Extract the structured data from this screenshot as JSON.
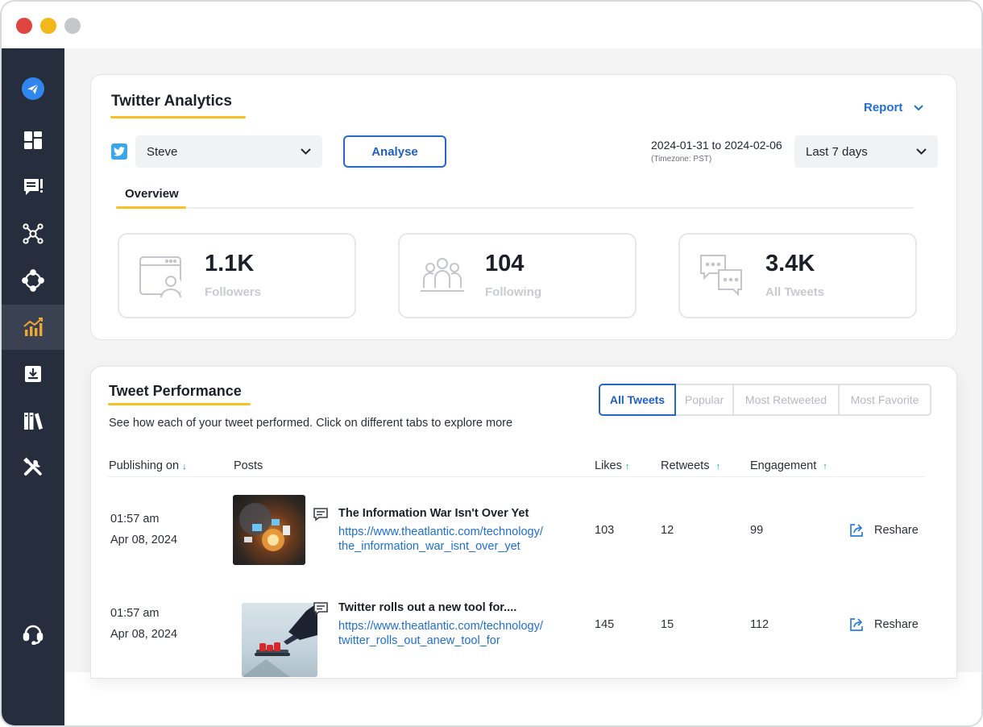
{
  "window": {
    "controls": [
      "close",
      "minimize",
      "maximize"
    ]
  },
  "sidebar": {
    "items": [
      {
        "icon": "send-icon",
        "active": false
      },
      {
        "icon": "dashboard-icon",
        "active": false
      },
      {
        "icon": "message-alert-icon",
        "active": false
      },
      {
        "icon": "network-icon",
        "active": false
      },
      {
        "icon": "hub-icon",
        "active": false
      },
      {
        "icon": "analytics-chart-icon",
        "active": true
      },
      {
        "icon": "download-tray-icon",
        "active": false
      },
      {
        "icon": "library-icon",
        "active": false
      },
      {
        "icon": "tools-icon",
        "active": false
      },
      {
        "icon": "headset-icon",
        "active": false
      }
    ]
  },
  "analytics": {
    "title": "Twitter Analytics",
    "report_label": "Report",
    "account": {
      "selected": "Steve"
    },
    "analyse_label": "Analyse",
    "date_range": "2024-01-31 to 2024-02-06",
    "timezone": "(Timezone: PST)",
    "range_selected": "Last 7 days",
    "tab": "Overview",
    "stats": [
      {
        "value": "1.1K",
        "label": "Followers",
        "icon": "followers-icon"
      },
      {
        "value": "104",
        "label": "Following",
        "icon": "following-group-icon"
      },
      {
        "value": "3.4K",
        "label": "All Tweets",
        "icon": "tweets-chat-icon"
      }
    ]
  },
  "performance": {
    "title": "Tweet Performance",
    "subtitle": "See how each of your tweet performed. Click on different tabs to explore more",
    "tabs": [
      "All Tweets",
      "Popular",
      "Most Retweeted",
      "Most Favorite"
    ],
    "active_tab": "All Tweets",
    "columns": {
      "publishing": "Publishing on",
      "posts": "Posts",
      "likes": "Likes",
      "retweets": "Retweets",
      "engagement": "Engagement"
    },
    "rows": [
      {
        "time": "01:57 am",
        "date": "Apr 08, 2024",
        "title": "The Information War Isn't Over Yet",
        "link_line1": "https://www.theatlantic.com/technology/",
        "link_line2": "the_information_war_isnt_over_yet",
        "likes": "103",
        "retweets": "12",
        "engagement": "99",
        "action": "Reshare"
      },
      {
        "time": "01:57 am",
        "date": "Apr 08, 2024",
        "title": "Twitter rolls out a new tool for....",
        "link_line1": "https://www.theatlantic.com/technology/",
        "link_line2": "twitter_rolls_out_anew_tool_for",
        "likes": "145",
        "retweets": "15",
        "engagement": "112",
        "action": "Reshare"
      }
    ]
  },
  "colors": {
    "sidebar_bg": "#262e3d",
    "accent_blue": "#1f6fd1",
    "underline_yellow": "#f5c124",
    "twitter_blue": "#3ba7e8"
  }
}
